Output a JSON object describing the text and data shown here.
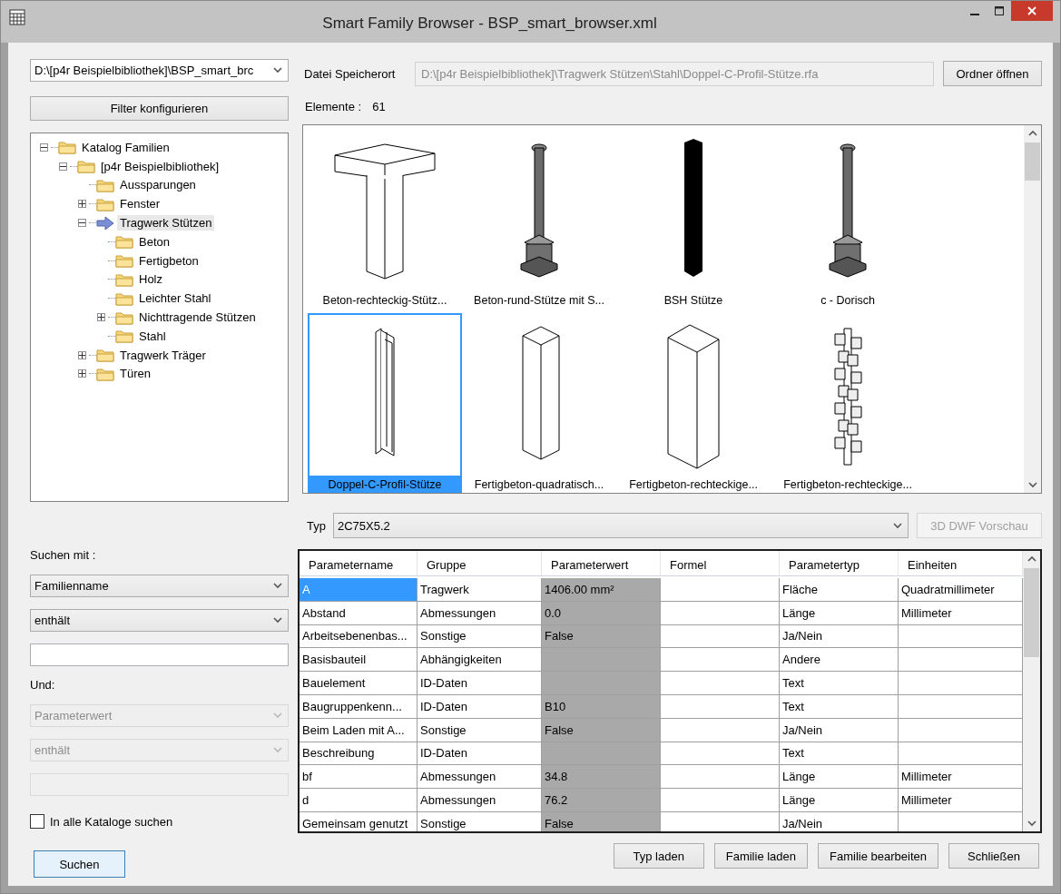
{
  "window": {
    "title": "Smart Family Browser - BSP_smart_browser.xml"
  },
  "catalog_select": {
    "value": "D:\\[p4r Beispielbibliothek]\\BSP_smart_brc"
  },
  "filter_button": "Filter konfigurieren",
  "tree": [
    {
      "label": "Katalog Familien",
      "expanded": true,
      "selected": false,
      "children": [
        {
          "label": "[p4r Beispielbibliothek]",
          "expanded": true,
          "selected": false,
          "children": [
            {
              "label": "Aussparungen",
              "selected": false
            },
            {
              "label": "Fenster",
              "expanded": false,
              "selected": false
            },
            {
              "label": "Tragwerk Stützen",
              "expanded": true,
              "selected": true,
              "children": [
                {
                  "label": "Beton",
                  "selected": false
                },
                {
                  "label": "Fertigbeton",
                  "selected": false
                },
                {
                  "label": "Holz",
                  "selected": false
                },
                {
                  "label": "Leichter Stahl",
                  "selected": false
                },
                {
                  "label": "Nichttragende Stützen",
                  "expanded": false,
                  "selected": false
                },
                {
                  "label": "Stahl",
                  "selected": false
                }
              ]
            },
            {
              "label": "Tragwerk Träger",
              "expanded": false,
              "selected": false
            },
            {
              "label": "Türen",
              "expanded": false,
              "selected": false
            }
          ]
        }
      ]
    }
  ],
  "search": {
    "label": "Suchen mit :",
    "controls": [
      {
        "kind": "select",
        "value": "Familienname",
        "disabled": false
      },
      {
        "kind": "select",
        "value": "enthält",
        "disabled": false
      },
      {
        "kind": "text",
        "disabled": false
      }
    ]
  },
  "and_search": {
    "label": "Und:",
    "controls": [
      {
        "kind": "select",
        "value": "Parameterwert",
        "disabled": true
      },
      {
        "kind": "select",
        "value": "enthält",
        "disabled": true
      },
      {
        "kind": "text",
        "disabled": true
      }
    ]
  },
  "all_catalogs": {
    "label": "In alle Kataloge suchen",
    "checked": false
  },
  "search_button": {
    "label": "Suchen",
    "focused": true
  },
  "file_location": {
    "label": "Datei Speicherort",
    "disabled": true,
    "value": "D:\\[p4r Beispielbibliothek]\\Tragwerk Stützen\\Stahl\\Doppel-C-Profil-Stütze.rfa",
    "button": "Ordner öffnen"
  },
  "elements": {
    "label": "Elemente :",
    "count": "61"
  },
  "gallery": {
    "items": [
      {
        "label": "Beton-rechteckig-Stütz...",
        "kind": "slab",
        "selected": false
      },
      {
        "label": "Beton-rund-Stütze mit S...",
        "kind": "round",
        "selected": false
      },
      {
        "label": "BSH Stütze",
        "kind": "solid",
        "selected": false
      },
      {
        "label": "c - Dorisch",
        "kind": "round",
        "selected": false
      },
      {
        "label": "Doppel-C-Profil-Stütze",
        "kind": "profile",
        "selected": true
      },
      {
        "label": "Fertigbeton-quadratisch...",
        "kind": "narrow",
        "selected": false
      },
      {
        "label": "Fertigbeton-rechteckige...",
        "kind": "wide",
        "selected": false
      },
      {
        "label": "Fertigbeton-rechteckige...",
        "kind": "blocks",
        "selected": false
      }
    ]
  },
  "type_row": {
    "label": "Typ",
    "value": "2C75X5.2",
    "preview_button": {
      "label": "3D DWF Vorschau",
      "disabled": true
    }
  },
  "table": {
    "columns": [
      {
        "label": "Parametername",
        "shaded": false
      },
      {
        "label": "Gruppe",
        "shaded": false
      },
      {
        "label": "Parameterwert",
        "shaded": true
      },
      {
        "label": "Formel",
        "shaded": false
      },
      {
        "label": "Parametertyp",
        "shaded": false
      },
      {
        "label": "Einheiten",
        "shaded": false
      }
    ],
    "rows": [
      {
        "selected": true,
        "cells": [
          "A",
          "Tragwerk",
          "1406.00 mm²",
          null,
          "Fläche",
          "Quadratmillimeter"
        ]
      },
      {
        "selected": false,
        "cells": [
          "Abstand",
          "Abmessungen",
          "0.0",
          null,
          "Länge",
          "Millimeter"
        ]
      },
      {
        "selected": false,
        "cells": [
          "Arbeitsebenenbas...",
          "Sonstige",
          "False",
          null,
          "Ja/Nein",
          null
        ]
      },
      {
        "selected": false,
        "cells": [
          "Basisbauteil",
          "Abhängigkeiten",
          null,
          null,
          "Andere",
          null
        ]
      },
      {
        "selected": false,
        "cells": [
          "Bauelement",
          "ID-Daten",
          null,
          null,
          "Text",
          null
        ]
      },
      {
        "selected": false,
        "cells": [
          "Baugruppenkenn...",
          "ID-Daten",
          "B10",
          null,
          "Text",
          null
        ]
      },
      {
        "selected": false,
        "cells": [
          "Beim Laden mit A...",
          "Sonstige",
          "False",
          null,
          "Ja/Nein",
          null
        ]
      },
      {
        "selected": false,
        "cells": [
          "Beschreibung",
          "ID-Daten",
          null,
          null,
          "Text",
          null
        ]
      },
      {
        "selected": false,
        "cells": [
          "bf",
          "Abmessungen",
          "34.8",
          null,
          "Länge",
          "Millimeter"
        ]
      },
      {
        "selected": false,
        "cells": [
          "d",
          "Abmessungen",
          "76.2",
          null,
          "Länge",
          "Millimeter"
        ]
      },
      {
        "selected": false,
        "cells": [
          "Gemeinsam genutzt",
          "Sonstige",
          "False",
          null,
          "Ja/Nein",
          null
        ]
      }
    ]
  },
  "buttons": [
    "Typ laden",
    "Familie laden",
    "Familie bearbeiten",
    "Schließen"
  ]
}
